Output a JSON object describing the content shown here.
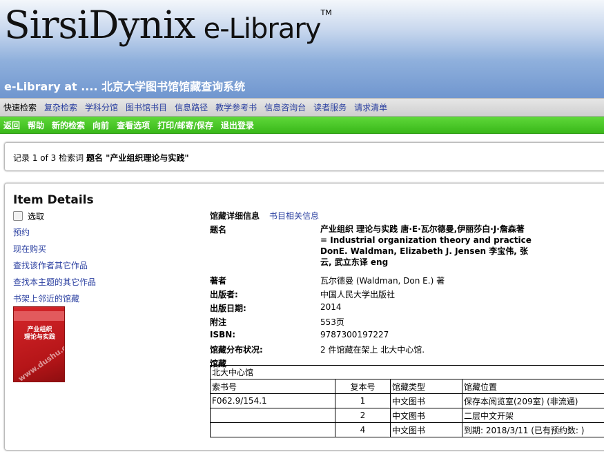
{
  "header": {
    "brand": "SirsiDynix",
    "product": "e-Library",
    "trademark": "TM",
    "site_title": "e-Library at .... 北京大学图书馆馆藏查询系统"
  },
  "nav_primary": [
    {
      "label": "快速检索",
      "active": true
    },
    {
      "label": "复杂检索"
    },
    {
      "label": "学科分馆"
    },
    {
      "label": "图书馆书目"
    },
    {
      "label": "信息路径"
    },
    {
      "label": "教学参考书"
    },
    {
      "label": "信息咨询台"
    },
    {
      "label": "读者服务"
    },
    {
      "label": "请求清单"
    }
  ],
  "nav_secondary": [
    "返回",
    "帮助",
    "新的检索",
    "向前",
    "查看选项",
    "打印/邮寄/保存",
    "退出登录"
  ],
  "record": {
    "prefix": "记录 1 of 3 检索词",
    "term": "题名 \"产业组织理论与实践\""
  },
  "details": {
    "heading": "Item Details",
    "select_label": "选取",
    "actions": [
      "预约",
      "现在购买",
      "查找该作者其它作品",
      "查找本主题的其它作品",
      "书架上邻近的馆藏"
    ],
    "cover": {
      "title_line1": "产业组织",
      "title_line2": "理论与实践",
      "watermark": "www.dushu.com"
    },
    "tabs": {
      "current": "馆藏详细信息",
      "other": "书目相关信息"
    },
    "fields": {
      "title_label": "题名",
      "title_value": "产业组织 理论与实践 唐·E·瓦尔德曼,伊丽莎白·J·詹森著 = Industrial organization theory and practice DonE. Waldman, Elizabeth J. Jensen 李宝伟, 张云, 武立东译 eng",
      "author_label": "著者",
      "author_value": "瓦尔德曼 (Waldman, Don E.) 著",
      "publisher_label": "出版者:",
      "publisher_value": "中国人民大学出版社",
      "date_label": "出版日期:",
      "date_value": "2014",
      "note_label": "附注",
      "note_value": "553页",
      "isbn_label": "ISBN:",
      "isbn_value": "9787300197227",
      "dist_label": "馆藏分布状况:",
      "dist_value": "2 件馆藏在架上 北大中心馆.",
      "holdings_label": "馆藏"
    },
    "holdings": {
      "library": "北大中心馆",
      "headers": [
        "索书号",
        "复本号",
        "馆藏类型",
        "馆藏位置"
      ],
      "rows": [
        {
          "call": "F062.9/154.1",
          "copy": "1",
          "type": "中文图书",
          "location": "保存本阅览室(209室) (非流通)"
        },
        {
          "call": "",
          "copy": "2",
          "type": "中文图书",
          "location": "二层中文开架"
        },
        {
          "call": "",
          "copy": "4",
          "type": "中文图书",
          "location": "到期: 2018/3/11 (已有预约数: )"
        }
      ]
    }
  }
}
